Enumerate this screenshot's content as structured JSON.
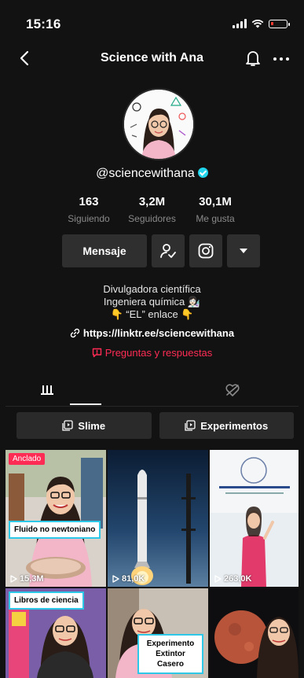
{
  "status": {
    "time": "15:16"
  },
  "header": {
    "title": "Science with Ana"
  },
  "profile": {
    "handle": "@sciencewithana",
    "stats": [
      {
        "value": "163",
        "label": "Siguiendo"
      },
      {
        "value": "3,2M",
        "label": "Seguidores"
      },
      {
        "value": "30,1M",
        "label": "Me gusta"
      }
    ],
    "message_label": "Mensaje",
    "bio": [
      "Divulgadora científica",
      "Ingeniera química 👩🏻‍🔬",
      "👇 “EL” enlace 👇"
    ],
    "link": "https://linktr.ee/sciencewithana",
    "qa": "Preguntas y respuestas"
  },
  "playlists": [
    "Slime",
    "Experimentos"
  ],
  "videos": [
    {
      "views": "15,3M",
      "pinned_label": "Anclado",
      "caption": "Fluido no newtoniano"
    },
    {
      "views": "81,0K"
    },
    {
      "views": "263,0K"
    },
    {
      "caption": "Libros de ciencia"
    },
    {
      "caption": "Experimento Extintor Casero"
    },
    {}
  ],
  "colors": {
    "accent": "#fe2c55",
    "verified": "#20d5ec",
    "background": "#121212"
  }
}
